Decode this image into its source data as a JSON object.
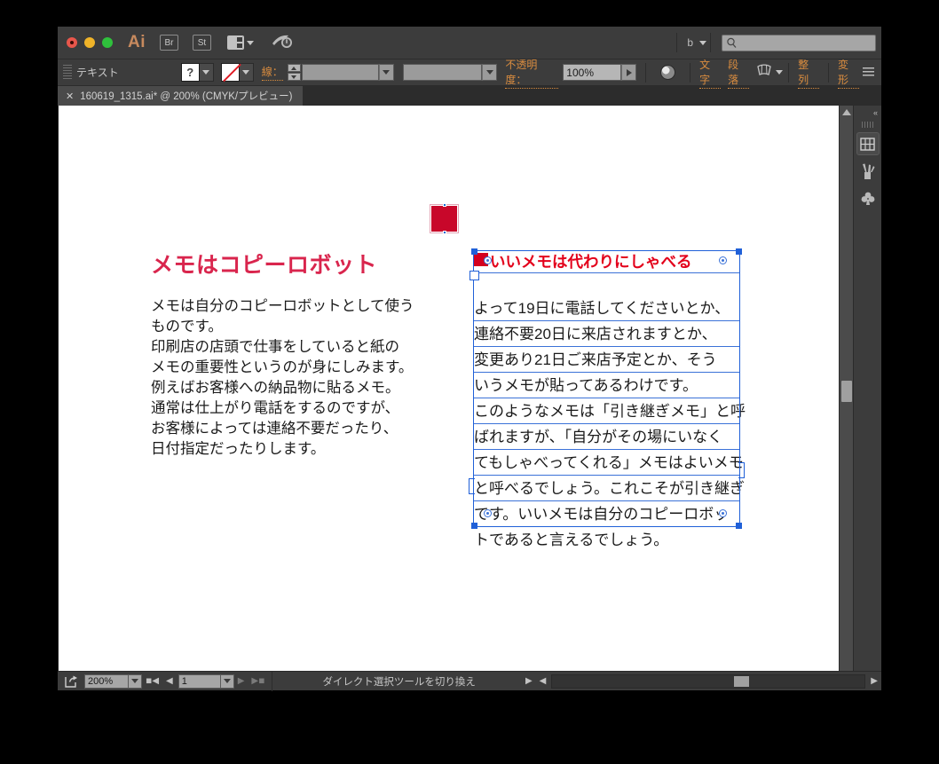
{
  "app": {
    "name": "Adobe Illustrator",
    "logo_text": "Ai"
  },
  "titlebar": {
    "bridge_button": "Br",
    "stock_button": "St",
    "arrange_icon": "arrange-documents-icon",
    "swoosh_icon": "illustrator-go-icon",
    "workspace_name": "b",
    "search_placeholder": "",
    "search_icon": "search-icon"
  },
  "control_bar": {
    "tool_label": "テキスト",
    "fill_swatch_label": "?",
    "stroke_swatch_label": "none",
    "stroke_label": "線：",
    "stroke_weight_value": "",
    "stroke_profile_value": "",
    "opacity_label": "不透明度：",
    "opacity_value": "100%",
    "recolor_icon": "recolor-artwork-icon",
    "character_menu": "文字",
    "paragraph_menu": "段落",
    "warp_icon": "envelope-warp-icon",
    "align_menu": "整列",
    "transform_menu": "変形",
    "overflow_icon": "panel-menu-icon"
  },
  "tab": {
    "close_icon": "close-icon",
    "title": "160619_1315.ai* @ 200% (CMYK/プレビュー)"
  },
  "document": {
    "red_square_color": "#c8072a",
    "left_column": {
      "heading": "メモはコピーロボット",
      "heading_color": "#d9254d",
      "lines": [
        "メモは自分のコピーロボットとして使う",
        "ものです。",
        "印刷店の店頭で仕事をしていると紙の",
        "メモの重要性というのが身にしみます。",
        "例えばお客様への納品物に貼るメモ。",
        "通常は仕上がり電話をするのですが、",
        "お客様によっては連絡不要だったり、",
        "日付指定だったりします。"
      ]
    },
    "selected_text_frame": {
      "heading": "いいメモは代わりにしゃべる",
      "heading_color": "#e3001b",
      "lines": [
        "よって19日に電話してくださいとか、",
        "連絡不要20日に来店されますとか、",
        "変更あり21日ご来店予定とか、そう",
        "いうメモが貼ってあるわけです。",
        "このようなメモは「引き継ぎメモ」と呼",
        "ばれますが、「自分がその場にいなく",
        "てもしゃべってくれる」メモはよいメモ",
        "と呼べるでしょう。これこそが引き継ぎ",
        "です。いいメモは自分のコピーロボッ",
        "トであると言えるでしょう。"
      ],
      "selection_color": "#2060d8"
    }
  },
  "dock": {
    "collapse_icon": "collapse-panels-icon",
    "items": [
      {
        "icon": "swatches-icon",
        "active": true
      },
      {
        "icon": "brushes-icon",
        "active": false
      },
      {
        "icon": "symbols-icon",
        "active": false
      }
    ]
  },
  "status_bar": {
    "export_icon": "export-selection-icon",
    "zoom_value": "200%",
    "first_page_icon": "first-page-icon",
    "prev_page_icon": "prev-page-icon",
    "page_value": "1",
    "next_page_icon": "next-page-icon",
    "last_page_icon": "last-page-icon",
    "status_text": "ダイレクト選択ツールを切り換え",
    "scroll_right_icon": "scroll-right-icon",
    "scroll_left_icon": "scroll-left-icon"
  }
}
